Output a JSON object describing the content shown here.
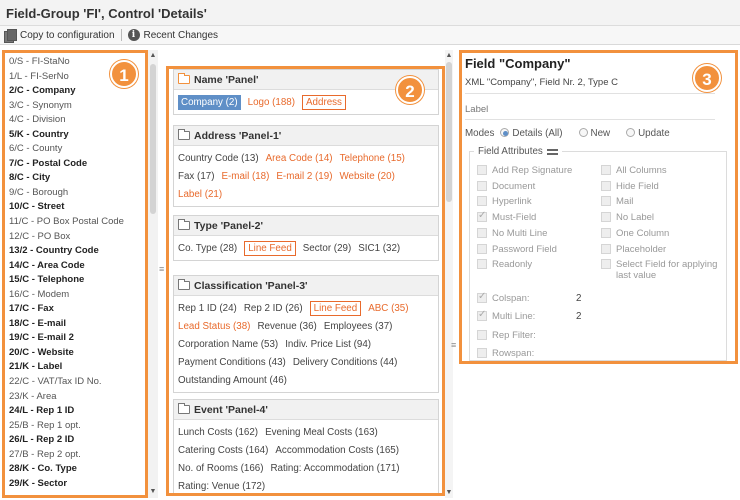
{
  "title": "Field-Group 'FI', Control 'Details'",
  "toolbar": {
    "copy_label": "Copy to configuration",
    "changes_label": "Recent Changes"
  },
  "badges": [
    "1",
    "2",
    "3"
  ],
  "left_list": [
    {
      "text": "0/S - FI-StaNo",
      "bold": false
    },
    {
      "text": "1/L - FI-SerNo",
      "bold": false
    },
    {
      "text": "2/C - Company",
      "bold": true
    },
    {
      "text": "3/C - Synonym",
      "bold": false
    },
    {
      "text": "4/C - Division",
      "bold": false
    },
    {
      "text": "5/K - Country",
      "bold": true
    },
    {
      "text": "6/C - County",
      "bold": false
    },
    {
      "text": "7/C - Postal Code",
      "bold": true
    },
    {
      "text": "8/C - City",
      "bold": true
    },
    {
      "text": "9/C - Borough",
      "bold": false
    },
    {
      "text": "10/C - Street",
      "bold": true
    },
    {
      "text": "11/C - PO Box Postal Code",
      "bold": false
    },
    {
      "text": "12/C - PO Box",
      "bold": false
    },
    {
      "text": "13/2 - Country Code",
      "bold": true
    },
    {
      "text": "14/C - Area Code",
      "bold": true
    },
    {
      "text": "15/C - Telephone",
      "bold": true
    },
    {
      "text": "16/C - Modem",
      "bold": false
    },
    {
      "text": "17/C - Fax",
      "bold": true
    },
    {
      "text": "18/C - E-mail",
      "bold": true
    },
    {
      "text": "19/C - E-mail 2",
      "bold": true
    },
    {
      "text": "20/C - Website",
      "bold": true
    },
    {
      "text": "21/K - Label",
      "bold": true
    },
    {
      "text": "22/C - VAT/Tax ID No.",
      "bold": false
    },
    {
      "text": "23/K - Area",
      "bold": false
    },
    {
      "text": "24/L - Rep 1 ID",
      "bold": true
    },
    {
      "text": "25/B - Rep 1 opt.",
      "bold": false
    },
    {
      "text": "26/L - Rep 2 ID",
      "bold": true
    },
    {
      "text": "27/B - Rep 2 opt.",
      "bold": false
    },
    {
      "text": "28/K - Co. Type",
      "bold": true
    },
    {
      "text": "29/K - Sector",
      "bold": true
    }
  ],
  "groups": [
    {
      "title": "Name 'Panel'",
      "open": true,
      "rows": [
        [
          {
            "t": "Company (2)",
            "s": "sel"
          },
          {
            "t": "Logo (188)",
            "s": "or"
          },
          {
            "t": "Address",
            "s": "boxed"
          }
        ]
      ]
    },
    {
      "title": "Address 'Panel-1'",
      "open": false,
      "rows": [
        [
          {
            "t": "Country Code (13)",
            "s": ""
          },
          {
            "t": "Area Code (14)",
            "s": "or"
          },
          {
            "t": "Telephone (15)",
            "s": "or"
          }
        ],
        [
          {
            "t": "Fax (17)",
            "s": ""
          },
          {
            "t": "E-mail (18)",
            "s": "or"
          },
          {
            "t": "E-mail 2 (19)",
            "s": "or"
          },
          {
            "t": "Website (20)",
            "s": "or"
          }
        ],
        [
          {
            "t": "Label (21)",
            "s": "or"
          }
        ]
      ]
    },
    {
      "title": "Type 'Panel-2'",
      "open": false,
      "rows": [
        [
          {
            "t": "Co. Type (28)",
            "s": ""
          },
          {
            "t": "Line Feed",
            "s": "boxed"
          },
          {
            "t": "Sector (29)",
            "s": ""
          },
          {
            "t": "SIC1 (32)",
            "s": ""
          }
        ]
      ]
    },
    {
      "title": "Classification 'Panel-3'",
      "open": false,
      "rows": [
        [
          {
            "t": "Rep 1 ID (24)",
            "s": ""
          },
          {
            "t": "Rep 2 ID (26)",
            "s": ""
          },
          {
            "t": "Line Feed",
            "s": "boxed"
          },
          {
            "t": "ABC (35)",
            "s": "or"
          }
        ],
        [
          {
            "t": "Lead Status (38)",
            "s": "or"
          },
          {
            "t": "Revenue (36)",
            "s": ""
          },
          {
            "t": "Employees (37)",
            "s": ""
          }
        ],
        [
          {
            "t": "Corporation Name (53)",
            "s": ""
          },
          {
            "t": "Indiv. Price List (94)",
            "s": ""
          }
        ],
        [
          {
            "t": "Payment Conditions (43)",
            "s": ""
          },
          {
            "t": "Delivery Conditions (44)",
            "s": ""
          }
        ],
        [
          {
            "t": "Outstanding Amount (46)",
            "s": ""
          }
        ]
      ]
    },
    {
      "title": "Event 'Panel-4'",
      "open": false,
      "rows": [
        [
          {
            "t": "Lunch Costs (162)",
            "s": ""
          },
          {
            "t": "Evening Meal Costs (163)",
            "s": ""
          }
        ],
        [
          {
            "t": "Catering Costs (164)",
            "s": ""
          },
          {
            "t": "Accommodation Costs (165)",
            "s": ""
          }
        ],
        [
          {
            "t": "No. of Rooms (166)",
            "s": ""
          },
          {
            "t": "Rating: Accommodation (171)",
            "s": ""
          }
        ],
        [
          {
            "t": "Rating: Venue (172)",
            "s": ""
          }
        ]
      ]
    }
  ],
  "right": {
    "title": "Field \"Company\"",
    "subtitle": "XML \"Company\", Field Nr. 2, Type C",
    "label": "Label",
    "modes_label": "Modes",
    "modes": [
      {
        "label": "Details (All)",
        "selected": true
      },
      {
        "label": "New",
        "selected": false
      },
      {
        "label": "Update",
        "selected": false
      }
    ],
    "attributes_title": "Field Attributes",
    "attr_left": [
      {
        "label": "Add Rep Signature",
        "checked": false
      },
      {
        "label": "Document",
        "checked": false
      },
      {
        "label": "Hyperlink",
        "checked": false
      },
      {
        "label": "Must-Field",
        "checked": true
      },
      {
        "label": "No Multi Line",
        "checked": false
      },
      {
        "label": "Password Field",
        "checked": false
      },
      {
        "label": "Readonly",
        "checked": false
      }
    ],
    "attr_right": [
      {
        "label": "All Columns",
        "checked": false
      },
      {
        "label": "Hide Field",
        "checked": false
      },
      {
        "label": "Mail",
        "checked": false
      },
      {
        "label": "No Label",
        "checked": false
      },
      {
        "label": "One Column",
        "checked": false
      },
      {
        "label": "Placeholder",
        "checked": false
      },
      {
        "label": "Select Field for applying last value",
        "checked": false
      }
    ],
    "extra": [
      {
        "label": "Colspan:",
        "checked": true,
        "value": "2"
      },
      {
        "label": "Multi Line:",
        "checked": true,
        "value": "2"
      },
      {
        "label": "Rep Filter:",
        "checked": false,
        "value": ""
      },
      {
        "label": "Rowspan:",
        "checked": false,
        "value": ""
      }
    ]
  }
}
